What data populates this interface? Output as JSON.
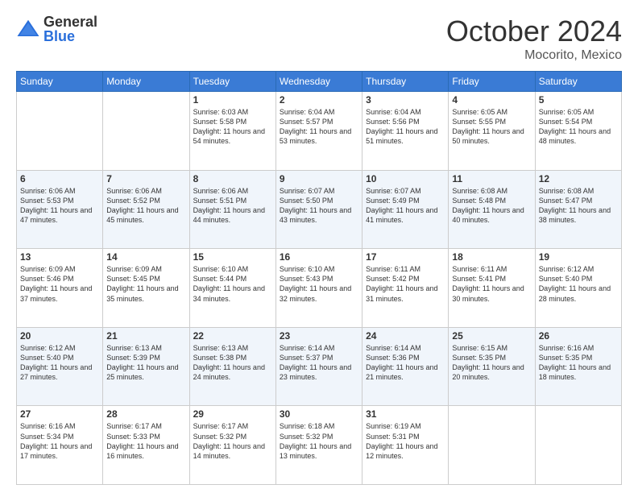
{
  "header": {
    "logo": {
      "general": "General",
      "blue": "Blue"
    },
    "title": "October 2024",
    "location": "Mocorito, Mexico"
  },
  "days_of_week": [
    "Sunday",
    "Monday",
    "Tuesday",
    "Wednesday",
    "Thursday",
    "Friday",
    "Saturday"
  ],
  "weeks": [
    [
      {
        "day": "",
        "text": ""
      },
      {
        "day": "",
        "text": ""
      },
      {
        "day": "1",
        "text": "Sunrise: 6:03 AM\nSunset: 5:58 PM\nDaylight: 11 hours and 54 minutes."
      },
      {
        "day": "2",
        "text": "Sunrise: 6:04 AM\nSunset: 5:57 PM\nDaylight: 11 hours and 53 minutes."
      },
      {
        "day": "3",
        "text": "Sunrise: 6:04 AM\nSunset: 5:56 PM\nDaylight: 11 hours and 51 minutes."
      },
      {
        "day": "4",
        "text": "Sunrise: 6:05 AM\nSunset: 5:55 PM\nDaylight: 11 hours and 50 minutes."
      },
      {
        "day": "5",
        "text": "Sunrise: 6:05 AM\nSunset: 5:54 PM\nDaylight: 11 hours and 48 minutes."
      }
    ],
    [
      {
        "day": "6",
        "text": "Sunrise: 6:06 AM\nSunset: 5:53 PM\nDaylight: 11 hours and 47 minutes."
      },
      {
        "day": "7",
        "text": "Sunrise: 6:06 AM\nSunset: 5:52 PM\nDaylight: 11 hours and 45 minutes."
      },
      {
        "day": "8",
        "text": "Sunrise: 6:06 AM\nSunset: 5:51 PM\nDaylight: 11 hours and 44 minutes."
      },
      {
        "day": "9",
        "text": "Sunrise: 6:07 AM\nSunset: 5:50 PM\nDaylight: 11 hours and 43 minutes."
      },
      {
        "day": "10",
        "text": "Sunrise: 6:07 AM\nSunset: 5:49 PM\nDaylight: 11 hours and 41 minutes."
      },
      {
        "day": "11",
        "text": "Sunrise: 6:08 AM\nSunset: 5:48 PM\nDaylight: 11 hours and 40 minutes."
      },
      {
        "day": "12",
        "text": "Sunrise: 6:08 AM\nSunset: 5:47 PM\nDaylight: 11 hours and 38 minutes."
      }
    ],
    [
      {
        "day": "13",
        "text": "Sunrise: 6:09 AM\nSunset: 5:46 PM\nDaylight: 11 hours and 37 minutes."
      },
      {
        "day": "14",
        "text": "Sunrise: 6:09 AM\nSunset: 5:45 PM\nDaylight: 11 hours and 35 minutes."
      },
      {
        "day": "15",
        "text": "Sunrise: 6:10 AM\nSunset: 5:44 PM\nDaylight: 11 hours and 34 minutes."
      },
      {
        "day": "16",
        "text": "Sunrise: 6:10 AM\nSunset: 5:43 PM\nDaylight: 11 hours and 32 minutes."
      },
      {
        "day": "17",
        "text": "Sunrise: 6:11 AM\nSunset: 5:42 PM\nDaylight: 11 hours and 31 minutes."
      },
      {
        "day": "18",
        "text": "Sunrise: 6:11 AM\nSunset: 5:41 PM\nDaylight: 11 hours and 30 minutes."
      },
      {
        "day": "19",
        "text": "Sunrise: 6:12 AM\nSunset: 5:40 PM\nDaylight: 11 hours and 28 minutes."
      }
    ],
    [
      {
        "day": "20",
        "text": "Sunrise: 6:12 AM\nSunset: 5:40 PM\nDaylight: 11 hours and 27 minutes."
      },
      {
        "day": "21",
        "text": "Sunrise: 6:13 AM\nSunset: 5:39 PM\nDaylight: 11 hours and 25 minutes."
      },
      {
        "day": "22",
        "text": "Sunrise: 6:13 AM\nSunset: 5:38 PM\nDaylight: 11 hours and 24 minutes."
      },
      {
        "day": "23",
        "text": "Sunrise: 6:14 AM\nSunset: 5:37 PM\nDaylight: 11 hours and 23 minutes."
      },
      {
        "day": "24",
        "text": "Sunrise: 6:14 AM\nSunset: 5:36 PM\nDaylight: 11 hours and 21 minutes."
      },
      {
        "day": "25",
        "text": "Sunrise: 6:15 AM\nSunset: 5:35 PM\nDaylight: 11 hours and 20 minutes."
      },
      {
        "day": "26",
        "text": "Sunrise: 6:16 AM\nSunset: 5:35 PM\nDaylight: 11 hours and 18 minutes."
      }
    ],
    [
      {
        "day": "27",
        "text": "Sunrise: 6:16 AM\nSunset: 5:34 PM\nDaylight: 11 hours and 17 minutes."
      },
      {
        "day": "28",
        "text": "Sunrise: 6:17 AM\nSunset: 5:33 PM\nDaylight: 11 hours and 16 minutes."
      },
      {
        "day": "29",
        "text": "Sunrise: 6:17 AM\nSunset: 5:32 PM\nDaylight: 11 hours and 14 minutes."
      },
      {
        "day": "30",
        "text": "Sunrise: 6:18 AM\nSunset: 5:32 PM\nDaylight: 11 hours and 13 minutes."
      },
      {
        "day": "31",
        "text": "Sunrise: 6:19 AM\nSunset: 5:31 PM\nDaylight: 11 hours and 12 minutes."
      },
      {
        "day": "",
        "text": ""
      },
      {
        "day": "",
        "text": ""
      }
    ]
  ]
}
